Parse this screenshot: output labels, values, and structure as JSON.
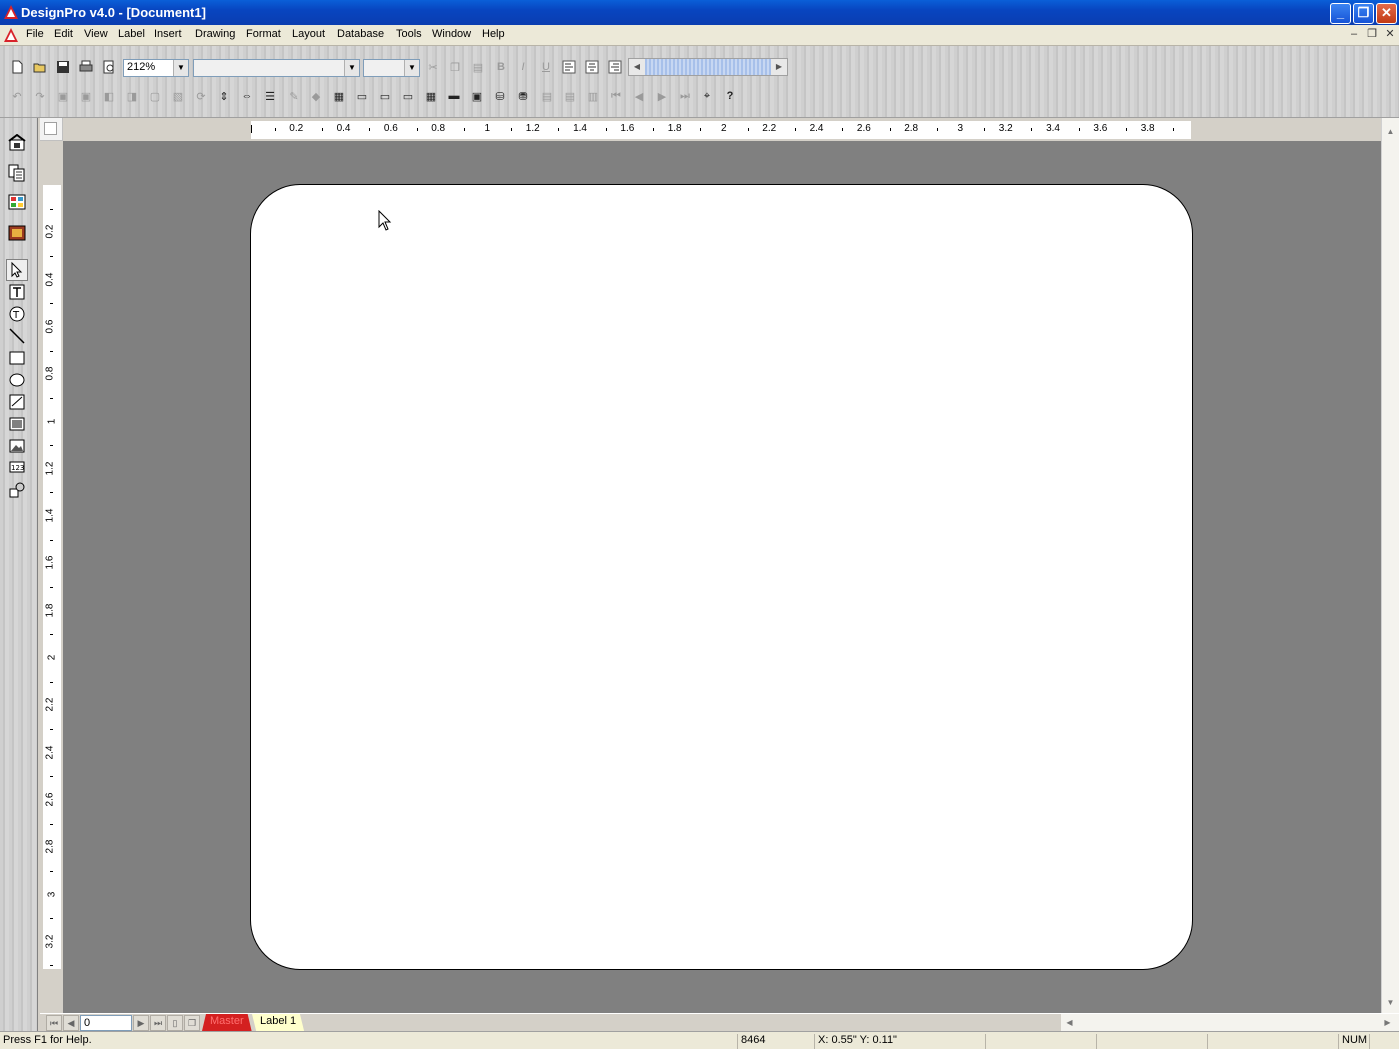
{
  "window": {
    "title": "DesignPro v4.0 - [Document1]",
    "minimize_label": "_",
    "restore_label": "❐",
    "close_label": "✕"
  },
  "menu": {
    "items": [
      "File",
      "Edit",
      "View",
      "Label",
      "Insert",
      "Drawing",
      "Format",
      "Layout",
      "Database",
      "Tools",
      "Window",
      "Help"
    ],
    "mdi_min": "–",
    "mdi_restore": "❐",
    "mdi_close": "✕"
  },
  "toolbar": {
    "zoom": "212%",
    "font_name": "",
    "font_size": "",
    "bold": "B",
    "italic": "I",
    "underline": "U"
  },
  "ruler": {
    "horizontal": [
      "0.2",
      "0.4",
      "0.6",
      "0.8",
      "1",
      "1.2",
      "1.4",
      "1.6",
      "1.8",
      "2",
      "2.2",
      "2.4",
      "2.6",
      "2.8",
      "3",
      "3.2",
      "3.4",
      "3.6",
      "3.8"
    ],
    "vertical": [
      "0.2",
      "0.4",
      "0.6",
      "0.8",
      "1",
      "1.2",
      "1.4",
      "1.6",
      "1.8",
      "2",
      "2.2",
      "2.4",
      "2.6",
      "2.8",
      "3",
      "3.2"
    ]
  },
  "navigation": {
    "page_number": "0",
    "tabs": [
      "Master",
      "Label 1"
    ]
  },
  "status": {
    "help": "Press F1 for Help.",
    "code": "8464",
    "position": "X: 0.55\"   Y: 0.11\"",
    "num": "NUM"
  },
  "colors": {
    "titlebar": "#0a4fd0",
    "workspace": "#808080",
    "master_tab": "#d42020",
    "label_tab": "#ffffcc"
  }
}
